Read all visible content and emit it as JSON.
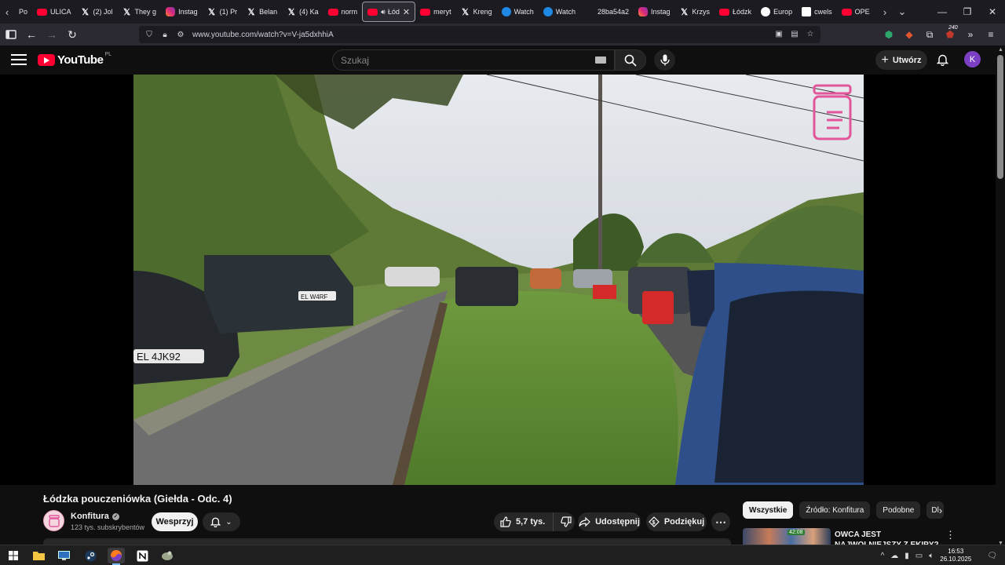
{
  "browser": {
    "tabs": [
      {
        "label": "Po",
        "favicon": "chevron-left-icon"
      },
      {
        "label": "ULICA",
        "favicon": "youtube-icon"
      },
      {
        "label": "(2) Jol",
        "favicon": "x-icon"
      },
      {
        "label": "They g",
        "favicon": "x-icon"
      },
      {
        "label": "Instag",
        "favicon": "instagram-icon"
      },
      {
        "label": "(1) Pr",
        "favicon": "x-icon"
      },
      {
        "label": "Belan",
        "favicon": "x-icon"
      },
      {
        "label": "(4) Ka",
        "favicon": "x-icon"
      },
      {
        "label": "norm",
        "favicon": "youtube-icon"
      },
      {
        "label": "Łód",
        "favicon": "youtube-icon",
        "active": true
      },
      {
        "label": "meryt",
        "favicon": "youtube-icon"
      },
      {
        "label": "Kreng",
        "favicon": "x-icon"
      },
      {
        "label": "Watch",
        "favicon": "blue-globe-icon"
      },
      {
        "label": "Watch",
        "favicon": "blue-globe-icon"
      },
      {
        "label": "28ba54a2",
        "favicon": "blank-icon"
      },
      {
        "label": "Instag",
        "favicon": "instagram-icon"
      },
      {
        "label": "Krzys",
        "favicon": "x-icon"
      },
      {
        "label": "Łódzk",
        "favicon": "youtube-icon"
      },
      {
        "label": "Europ",
        "favicon": "circle-icon"
      },
      {
        "label": "cwels",
        "favicon": "sheet-icon"
      },
      {
        "label": "OPE",
        "favicon": "youtube-icon"
      }
    ],
    "url": "www.youtube.com/watch?v=V-ja5dxhhiA",
    "extension_badge": "240"
  },
  "youtube": {
    "logo_text": "YouTube",
    "country_code": "PL",
    "search_placeholder": "Szukaj",
    "create_label": "Utwórz",
    "avatar_letter": "K"
  },
  "video": {
    "title": "Łódzka pouczeniówka (Giełda - Odc. 4)",
    "plate_left": "EL 4JK92",
    "plate_center": "EL W4RF"
  },
  "channel": {
    "name": "Konfitura",
    "subscribers": "123 tys. subskrybentów",
    "support_label": "Wesprzyj"
  },
  "actions": {
    "likes": "5,7 tys.",
    "share_label": "Udostępnij",
    "thanks_label": "Podziękuj"
  },
  "sidebar": {
    "chips": [
      "Wszystkie",
      "Źródło: Konfitura",
      "Podobne",
      "Dl"
    ],
    "rec_title": "OWCA JEST NAJWOLNIEJSZY Z EKIPY? #MEGA RACE",
    "rec_badge": "42:08"
  },
  "taskbar": {
    "time": "16:53",
    "date": "26.10.2025"
  },
  "colors": {
    "youtube_red": "#ff0033",
    "background": "#0f0f0f",
    "avatar_purple": "#7b3fc4"
  }
}
